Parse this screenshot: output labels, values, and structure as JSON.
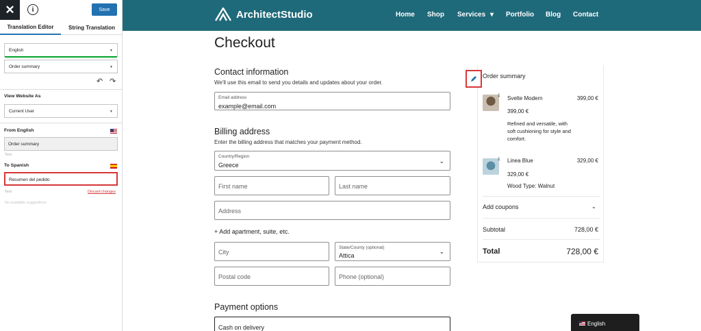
{
  "panel": {
    "close_glyph": "✕",
    "info_glyph": "i",
    "save_label": "Save",
    "tabs": [
      {
        "label": "Translation Editor",
        "active": true
      },
      {
        "label": "String Translation",
        "active": false
      }
    ],
    "language_select": "English",
    "string_select": "Order summary",
    "undo_glyph": "↶",
    "redo_glyph": "↷",
    "view_as_label": "View Website As",
    "view_as_select": "Current User",
    "from_label": "From English",
    "source_text": "Order summary",
    "source_hint": "Text",
    "to_label": "To Spanish",
    "target_text": "Resumen del pedido",
    "target_hint": "Text",
    "discard_label": "Discard changes",
    "suggestion_note": "No available suggestions"
  },
  "header": {
    "logo_text": "ArchitectStudio",
    "nav": [
      "Home",
      "Shop",
      "Services",
      "Portfolio",
      "Blog",
      "Contact"
    ],
    "services_caret": "▾",
    "bg_color": "#1f6a7a"
  },
  "checkout": {
    "title": "Checkout",
    "contact": {
      "title": "Contact information",
      "desc": "We'll use this email to send you details and updates about your order.",
      "email_label": "Email address",
      "email_value": "example@email.com"
    },
    "billing": {
      "title": "Billing address",
      "desc": "Enter the billing address that matches your payment method.",
      "country_label": "Country/Region",
      "country_value": "Greece",
      "first_name": "First name",
      "last_name": "Last name",
      "address": "Address",
      "add_apartment": "+ Add apartment, suite, etc.",
      "city": "City",
      "state_label": "State/County (optional)",
      "state_value": "Attica",
      "postal_code": "Postal code",
      "phone": "Phone (optional)"
    },
    "payment": {
      "title": "Payment options",
      "option": "Cash on delivery"
    }
  },
  "order_summary": {
    "title": "Order summary",
    "items": [
      {
        "qty": "1",
        "name": "Svelte Modern",
        "price": "399,00 €",
        "unit_price": "399,00 €",
        "desc": "Refined and versatile, with soft cushioning for style and comfort."
      },
      {
        "qty": "1",
        "name": "Linea Blue",
        "price": "329,00 €",
        "unit_price": "329,00 €",
        "desc": "Wood Type: Walnut"
      }
    ],
    "coupons_label": "Add coupons",
    "subtotal_label": "Subtotal",
    "subtotal_value": "728,00 €",
    "total_label": "Total",
    "total_value": "728,00 €"
  },
  "language_switcher": {
    "label": "English"
  }
}
